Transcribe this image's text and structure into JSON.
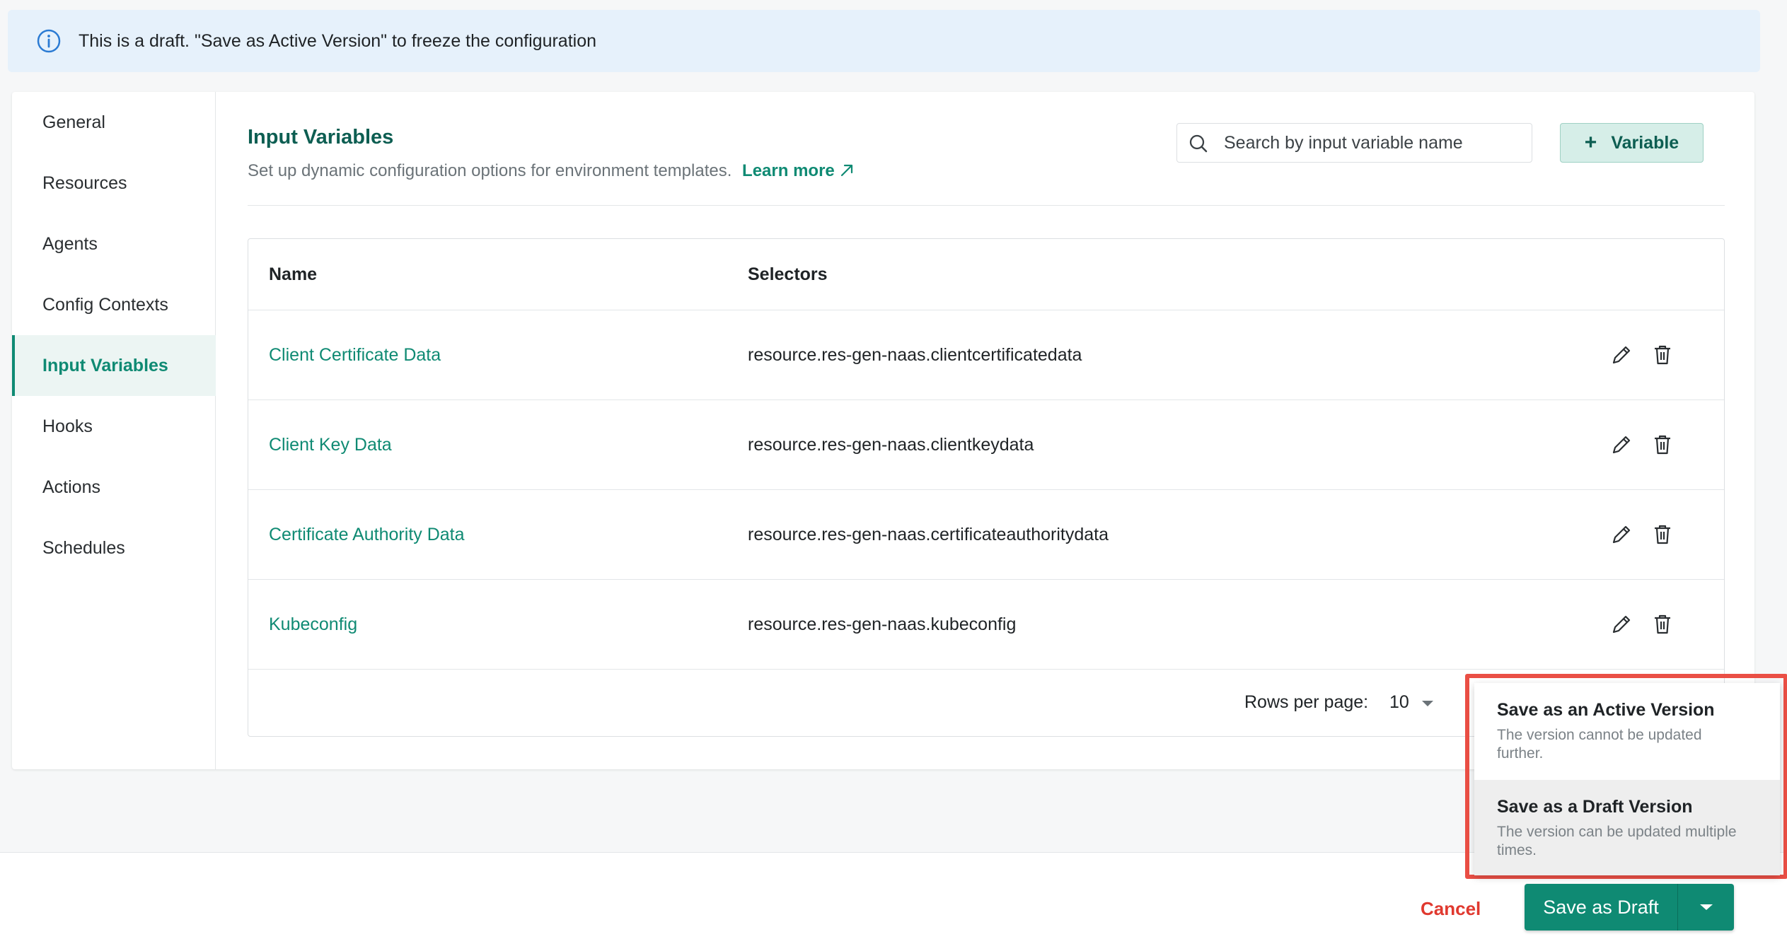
{
  "banner": {
    "text": "This is a draft. \"Save as Active Version\" to freeze the configuration"
  },
  "sidebar": {
    "items": [
      {
        "label": "General"
      },
      {
        "label": "Resources"
      },
      {
        "label": "Agents"
      },
      {
        "label": "Config Contexts"
      },
      {
        "label": "Input Variables",
        "active": true
      },
      {
        "label": "Hooks"
      },
      {
        "label": "Actions"
      },
      {
        "label": "Schedules"
      }
    ]
  },
  "header": {
    "title": "Input Variables",
    "subtitle": "Set up dynamic configuration options for environment templates.",
    "learn_more": "Learn more"
  },
  "search": {
    "placeholder": "Search by input variable name",
    "value": ""
  },
  "add_variable": {
    "plus": "+",
    "label": "Variable"
  },
  "table": {
    "columns": [
      "Name",
      "Selectors"
    ],
    "rows": [
      {
        "name": "Client Certificate Data",
        "selector": "resource.res-gen-naas.clientcertificatedata"
      },
      {
        "name": "Client Key Data",
        "selector": "resource.res-gen-naas.clientkeydata"
      },
      {
        "name": "Certificate Authority Data",
        "selector": "resource.res-gen-naas.certificateauthoritydata"
      },
      {
        "name": "Kubeconfig",
        "selector": "resource.res-gen-naas.kubeconfig"
      }
    ]
  },
  "pagination": {
    "rows_per_page_label": "Rows per page:",
    "rows_per_page_value": "10"
  },
  "footer": {
    "cancel_label": "Cancel",
    "save_label": "Save as Draft"
  },
  "save_menu": {
    "items": [
      {
        "title": "Save as an Active Version",
        "description": "The version cannot be updated further."
      },
      {
        "title": "Save as a Draft Version",
        "description": "The version can be updated multiple times.",
        "highlighted": true
      }
    ]
  },
  "colors": {
    "accent": "#0f8a73",
    "title": "#0d5e52",
    "cancel": "#e0392f",
    "banner_bg": "#e6f1fb",
    "highlight_outline": "#ea4f45"
  },
  "icons": {
    "banner": "info-icon",
    "search": "search-icon",
    "edit": "pencil-icon",
    "delete": "trash-icon",
    "external": "external-link-icon",
    "dropdown": "caret-down-icon"
  }
}
